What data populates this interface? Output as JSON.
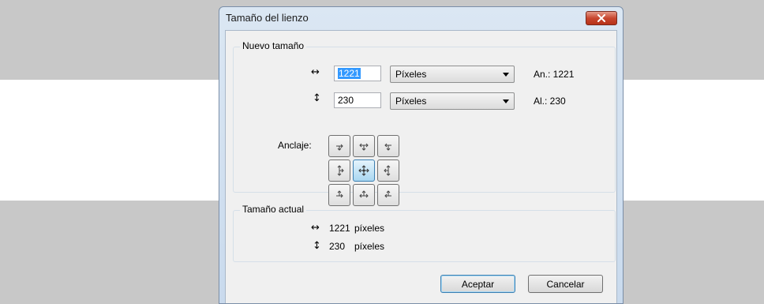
{
  "dialog": {
    "title": "Tamaño del lienzo"
  },
  "new_size": {
    "legend": "Nuevo tamaño",
    "width_arrow": "↔",
    "width_value": "1221",
    "width_unit": "Píxeles",
    "width_label": "An.: 1221",
    "height_arrow": "↕",
    "height_value": "230",
    "height_unit": "Píxeles",
    "height_label": "Al.: 230",
    "anchor_label": "Anclaje:",
    "anchor_selected": "center"
  },
  "current_size": {
    "legend": "Tamaño actual",
    "width_arrow": "↔",
    "width_value": "1221",
    "width_unit": "píxeles",
    "height_arrow": "↕",
    "height_value": "230",
    "height_unit": "píxeles"
  },
  "buttons": {
    "ok": "Aceptar",
    "cancel": "Cancelar"
  },
  "colors": {
    "close_button": "#c8472f",
    "selection": "#3399ff",
    "anchor_active": "#a9d7f1"
  }
}
